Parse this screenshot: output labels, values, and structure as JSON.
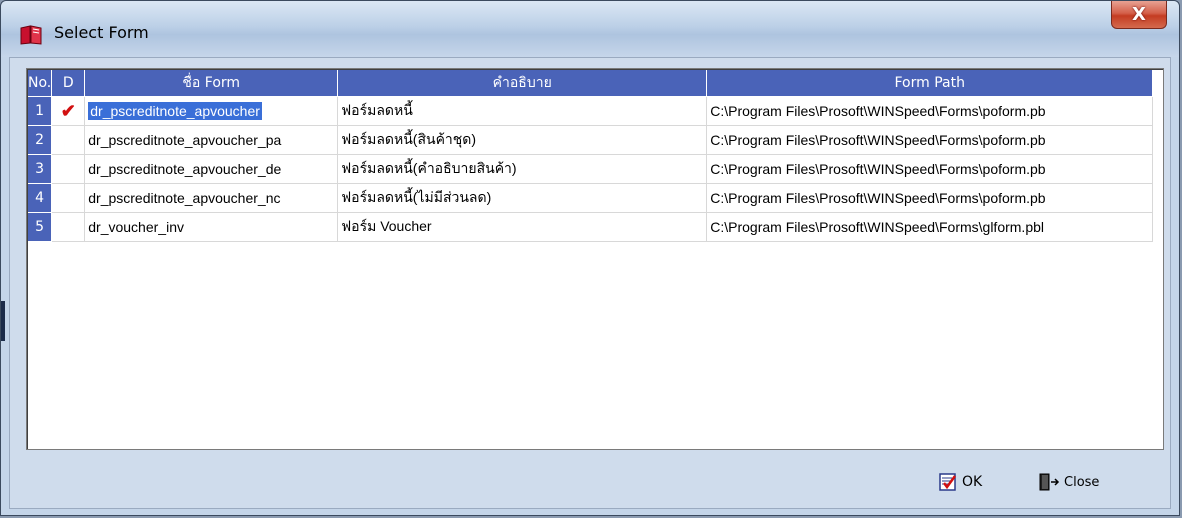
{
  "window": {
    "title": "Select Form",
    "close_label": "X"
  },
  "grid": {
    "headers": {
      "no": "No.",
      "d": "D",
      "name": "ชื่อ Form",
      "desc": "คำอธิบาย",
      "path": "Form Path"
    },
    "rows": [
      {
        "no": "1",
        "d": "✔",
        "name": "dr_pscreditnote_apvoucher",
        "desc": "ฟอร์มลดหนี้",
        "path": "C:\\Program Files\\Prosoft\\WINSpeed\\Forms\\poform.pb",
        "selected": true
      },
      {
        "no": "2",
        "d": "",
        "name": "dr_pscreditnote_apvoucher_pa",
        "desc": "ฟอร์มลดหนี้(สินค้าชุด)",
        "path": "C:\\Program Files\\Prosoft\\WINSpeed\\Forms\\poform.pb"
      },
      {
        "no": "3",
        "d": "",
        "name": "dr_pscreditnote_apvoucher_de",
        "desc": "ฟอร์มลดหนี้(คำอธิบายสินค้า)",
        "path": "C:\\Program Files\\Prosoft\\WINSpeed\\Forms\\poform.pb"
      },
      {
        "no": "4",
        "d": "",
        "name": "dr_pscreditnote_apvoucher_nc",
        "desc": "ฟอร์มลดหนี้(ไม่มีส่วนลด)",
        "path": "C:\\Program Files\\Prosoft\\WINSpeed\\Forms\\poform.pb"
      },
      {
        "no": "5",
        "d": "",
        "name": "dr_voucher_inv",
        "desc": "ฟอร์ม Voucher",
        "path": "C:\\Program Files\\Prosoft\\WINSpeed\\Forms\\glform.pbl"
      }
    ]
  },
  "buttons": {
    "ok": "OK",
    "close": "Close"
  },
  "colors": {
    "header_bg": "#4a63b8",
    "selection": "#3a6fd8",
    "check": "#d21010"
  }
}
